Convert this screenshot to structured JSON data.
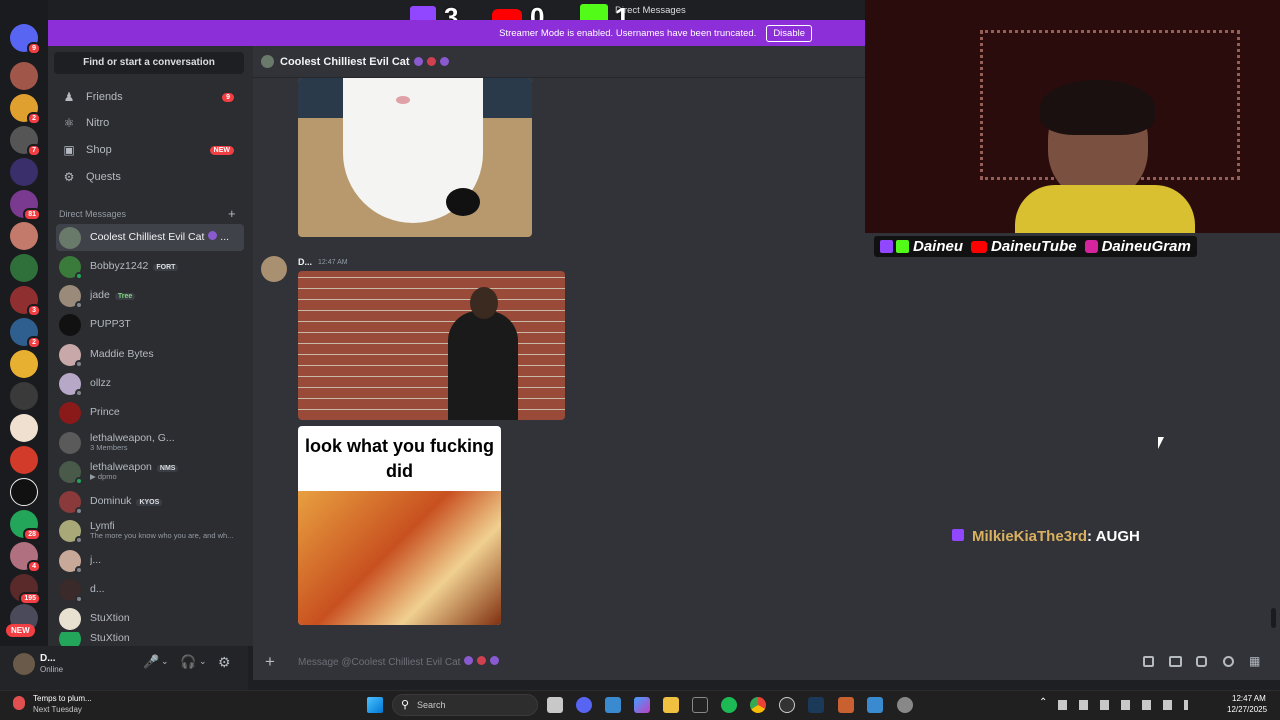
{
  "window": {
    "title": "Direct Messages"
  },
  "stream_counters": {
    "twitch": "3",
    "youtube": "0",
    "kick": "1"
  },
  "streamer_banner": {
    "message": "Streamer Mode is enabled. Usernames have been truncated.",
    "disable_label": "Disable"
  },
  "server_rail": {
    "badges": [
      "9",
      "2",
      "7",
      "81",
      "3",
      "2",
      "28",
      "4",
      "195"
    ],
    "new_label": "NEW"
  },
  "sidebar": {
    "search_label": "Find or start a conversation",
    "nav": [
      {
        "label": "Friends",
        "icon": "friends-icon",
        "count": "9"
      },
      {
        "label": "Nitro",
        "icon": "nitro-icon"
      },
      {
        "label": "Shop",
        "icon": "shop-icon",
        "badge": "NEW"
      },
      {
        "label": "Quests",
        "icon": "quests-icon"
      }
    ],
    "dm_header": "Direct Messages",
    "dms": [
      {
        "name": "Coolest Chilliest Evil Cat",
        "suffix": "...",
        "active": true
      },
      {
        "name": "Bobbyz1242",
        "tag": "FORT"
      },
      {
        "name": "jade",
        "tag": "Tree"
      },
      {
        "name": "PUPP3T"
      },
      {
        "name": "Maddie Bytes"
      },
      {
        "name": "ollzz"
      },
      {
        "name": "Prince"
      },
      {
        "name": "lethalweapon, G...",
        "sub": "3 Members"
      },
      {
        "name": "lethalweapon",
        "tag": "NMS",
        "sub": "dpmo"
      },
      {
        "name": "Dominuk",
        "tag": "KYOS"
      },
      {
        "name": "Lymfi",
        "sub": "The more you know who you are, and wh..."
      },
      {
        "name": "j..."
      },
      {
        "name": "d..."
      },
      {
        "name": "StuXtion"
      },
      {
        "name": "StuXtion"
      }
    ]
  },
  "user_panel": {
    "name": "D...",
    "status": "Online"
  },
  "chat": {
    "header": "Coolest Chilliest Evil Cat",
    "message_author": "D...",
    "message_time": "12:47 AM",
    "meme_text": "look what you fucking did",
    "composer_placeholder": "Message @Coolest Chilliest Evil Cat"
  },
  "stream_overlay": {
    "socials": [
      "Daineu",
      "DaineuTube",
      "DaineuGram"
    ],
    "chat_user": "MilkieKiaThe3rd",
    "chat_message": ": AUGH"
  },
  "taskbar": {
    "weather_line1": "Temps to plum...",
    "weather_line2": "Next Tuesday",
    "search_label": "Search",
    "time": "12:47 AM",
    "date": "12/27/2025"
  },
  "colors": {
    "accent_purple": "#8c2fd9",
    "discord_blurple": "#5865f2",
    "red_badge": "#f23f43"
  }
}
